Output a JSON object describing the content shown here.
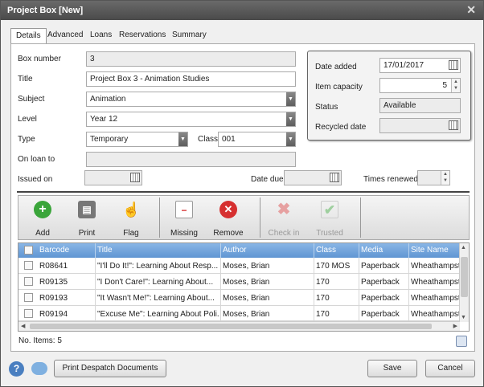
{
  "window": {
    "title": "Project Box [New]",
    "close": "✕"
  },
  "tabs": [
    "Details",
    "Advanced",
    "Loans",
    "Reservations",
    "Summary"
  ],
  "form": {
    "box_number_label": "Box number",
    "box_number": "3",
    "title_label": "Title",
    "title": "Project Box 3 - Animation Studies",
    "subject_label": "Subject",
    "subject": "Animation",
    "level_label": "Level",
    "level": "Year 12",
    "type_label": "Type",
    "type": "Temporary",
    "class_label": "Class",
    "class": "001",
    "on_loan_label": "On loan to",
    "on_loan": "",
    "issued_label": "Issued on",
    "issued": "",
    "due_label": "Date due",
    "due": "",
    "renewed_label": "Times renewed",
    "renewed": ""
  },
  "side": {
    "date_added_label": "Date added",
    "date_added": "17/01/2017",
    "capacity_label": "Item capacity",
    "capacity": "5",
    "status_label": "Status",
    "status": "Available",
    "recycled_label": "Recycled date",
    "recycled": ""
  },
  "toolbar": {
    "add": "Add",
    "print": "Print",
    "flag": "Flag",
    "missing": "Missing",
    "remove": "Remove",
    "checkin": "Check in",
    "trusted": "Trusted"
  },
  "grid": {
    "headers": [
      "Barcode",
      "Title",
      "Author",
      "Class",
      "Media",
      "Site Name"
    ],
    "rows": [
      [
        "R08641",
        "\"I'll Do It!\": Learning About Resp...",
        "Moses, Brian",
        "170 MOS",
        "Paperback",
        "Wheathampst"
      ],
      [
        "R09135",
        "\"I Don't Care!\": Learning About...",
        "Moses, Brian",
        "170",
        "Paperback",
        "Wheathampst"
      ],
      [
        "R09193",
        "\"It Wasn't Me!\": Learning About...",
        "Moses, Brian",
        "170",
        "Paperback",
        "Wheathampst"
      ],
      [
        "R09194",
        "\"Excuse Me\": Learning About Poli...",
        "Moses, Brian",
        "170",
        "Paperback",
        "Wheathampst"
      ]
    ]
  },
  "footer": {
    "items": "No. Items: 5",
    "print_despatch": "Print Despatch Documents",
    "save": "Save",
    "cancel": "Cancel"
  },
  "colors": {
    "header_blue": "#5f95d2",
    "add_green": "#3aa53a",
    "remove_red": "#d63030"
  }
}
